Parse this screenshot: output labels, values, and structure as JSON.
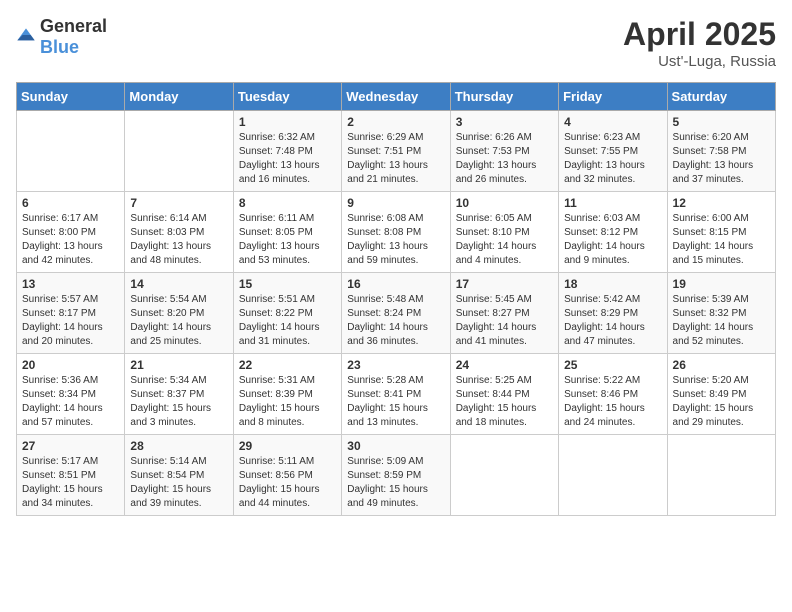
{
  "header": {
    "logo_general": "General",
    "logo_blue": "Blue",
    "title": "April 2025",
    "subtitle": "Ust'-Luga, Russia"
  },
  "calendar": {
    "days_of_week": [
      "Sunday",
      "Monday",
      "Tuesday",
      "Wednesday",
      "Thursday",
      "Friday",
      "Saturday"
    ],
    "weeks": [
      [
        {
          "day": "",
          "info": ""
        },
        {
          "day": "",
          "info": ""
        },
        {
          "day": "1",
          "info": "Sunrise: 6:32 AM\nSunset: 7:48 PM\nDaylight: 13 hours and 16 minutes."
        },
        {
          "day": "2",
          "info": "Sunrise: 6:29 AM\nSunset: 7:51 PM\nDaylight: 13 hours and 21 minutes."
        },
        {
          "day": "3",
          "info": "Sunrise: 6:26 AM\nSunset: 7:53 PM\nDaylight: 13 hours and 26 minutes."
        },
        {
          "day": "4",
          "info": "Sunrise: 6:23 AM\nSunset: 7:55 PM\nDaylight: 13 hours and 32 minutes."
        },
        {
          "day": "5",
          "info": "Sunrise: 6:20 AM\nSunset: 7:58 PM\nDaylight: 13 hours and 37 minutes."
        }
      ],
      [
        {
          "day": "6",
          "info": "Sunrise: 6:17 AM\nSunset: 8:00 PM\nDaylight: 13 hours and 42 minutes."
        },
        {
          "day": "7",
          "info": "Sunrise: 6:14 AM\nSunset: 8:03 PM\nDaylight: 13 hours and 48 minutes."
        },
        {
          "day": "8",
          "info": "Sunrise: 6:11 AM\nSunset: 8:05 PM\nDaylight: 13 hours and 53 minutes."
        },
        {
          "day": "9",
          "info": "Sunrise: 6:08 AM\nSunset: 8:08 PM\nDaylight: 13 hours and 59 minutes."
        },
        {
          "day": "10",
          "info": "Sunrise: 6:05 AM\nSunset: 8:10 PM\nDaylight: 14 hours and 4 minutes."
        },
        {
          "day": "11",
          "info": "Sunrise: 6:03 AM\nSunset: 8:12 PM\nDaylight: 14 hours and 9 minutes."
        },
        {
          "day": "12",
          "info": "Sunrise: 6:00 AM\nSunset: 8:15 PM\nDaylight: 14 hours and 15 minutes."
        }
      ],
      [
        {
          "day": "13",
          "info": "Sunrise: 5:57 AM\nSunset: 8:17 PM\nDaylight: 14 hours and 20 minutes."
        },
        {
          "day": "14",
          "info": "Sunrise: 5:54 AM\nSunset: 8:20 PM\nDaylight: 14 hours and 25 minutes."
        },
        {
          "day": "15",
          "info": "Sunrise: 5:51 AM\nSunset: 8:22 PM\nDaylight: 14 hours and 31 minutes."
        },
        {
          "day": "16",
          "info": "Sunrise: 5:48 AM\nSunset: 8:24 PM\nDaylight: 14 hours and 36 minutes."
        },
        {
          "day": "17",
          "info": "Sunrise: 5:45 AM\nSunset: 8:27 PM\nDaylight: 14 hours and 41 minutes."
        },
        {
          "day": "18",
          "info": "Sunrise: 5:42 AM\nSunset: 8:29 PM\nDaylight: 14 hours and 47 minutes."
        },
        {
          "day": "19",
          "info": "Sunrise: 5:39 AM\nSunset: 8:32 PM\nDaylight: 14 hours and 52 minutes."
        }
      ],
      [
        {
          "day": "20",
          "info": "Sunrise: 5:36 AM\nSunset: 8:34 PM\nDaylight: 14 hours and 57 minutes."
        },
        {
          "day": "21",
          "info": "Sunrise: 5:34 AM\nSunset: 8:37 PM\nDaylight: 15 hours and 3 minutes."
        },
        {
          "day": "22",
          "info": "Sunrise: 5:31 AM\nSunset: 8:39 PM\nDaylight: 15 hours and 8 minutes."
        },
        {
          "day": "23",
          "info": "Sunrise: 5:28 AM\nSunset: 8:41 PM\nDaylight: 15 hours and 13 minutes."
        },
        {
          "day": "24",
          "info": "Sunrise: 5:25 AM\nSunset: 8:44 PM\nDaylight: 15 hours and 18 minutes."
        },
        {
          "day": "25",
          "info": "Sunrise: 5:22 AM\nSunset: 8:46 PM\nDaylight: 15 hours and 24 minutes."
        },
        {
          "day": "26",
          "info": "Sunrise: 5:20 AM\nSunset: 8:49 PM\nDaylight: 15 hours and 29 minutes."
        }
      ],
      [
        {
          "day": "27",
          "info": "Sunrise: 5:17 AM\nSunset: 8:51 PM\nDaylight: 15 hours and 34 minutes."
        },
        {
          "day": "28",
          "info": "Sunrise: 5:14 AM\nSunset: 8:54 PM\nDaylight: 15 hours and 39 minutes."
        },
        {
          "day": "29",
          "info": "Sunrise: 5:11 AM\nSunset: 8:56 PM\nDaylight: 15 hours and 44 minutes."
        },
        {
          "day": "30",
          "info": "Sunrise: 5:09 AM\nSunset: 8:59 PM\nDaylight: 15 hours and 49 minutes."
        },
        {
          "day": "",
          "info": ""
        },
        {
          "day": "",
          "info": ""
        },
        {
          "day": "",
          "info": ""
        }
      ]
    ]
  }
}
